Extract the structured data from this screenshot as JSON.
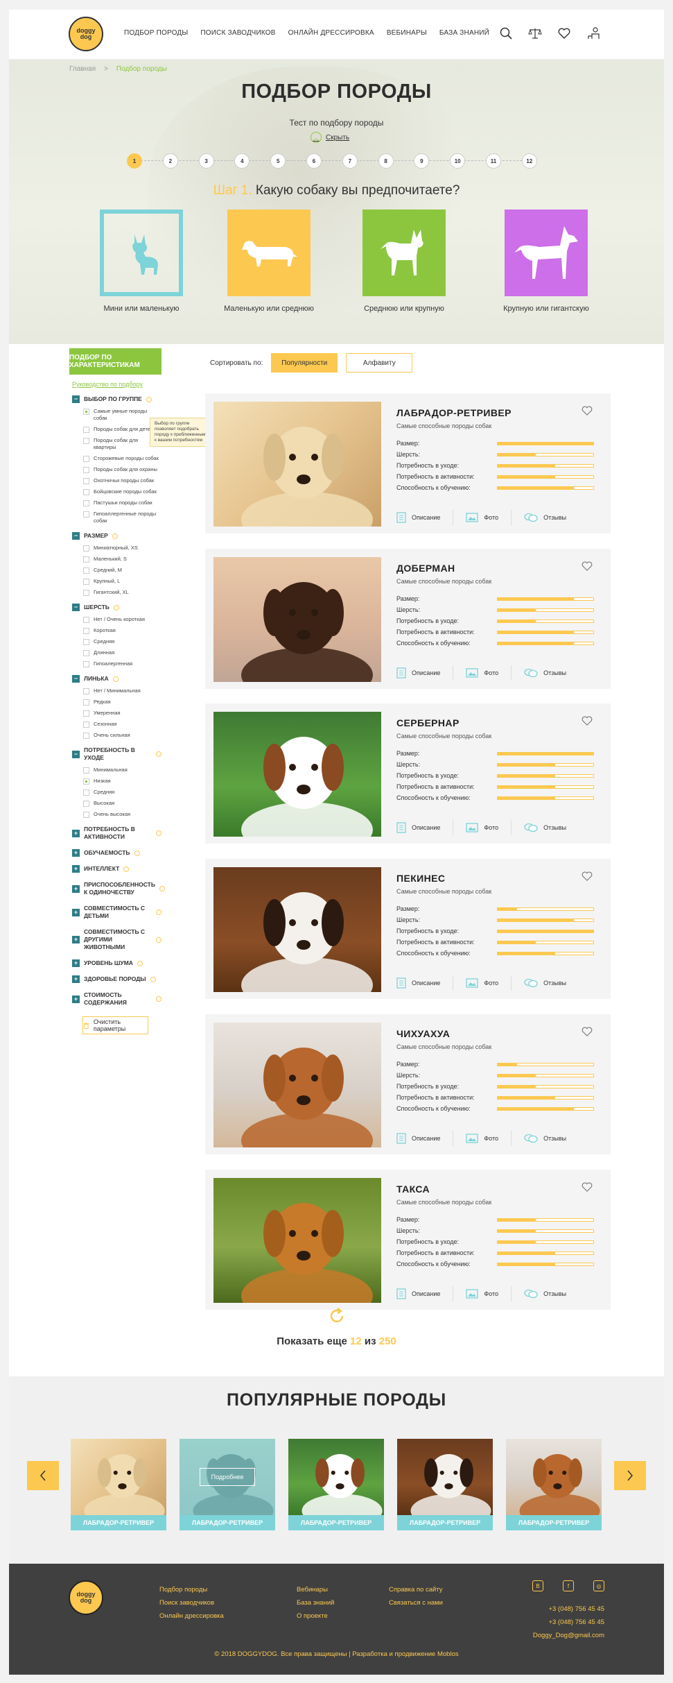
{
  "logo": {
    "line1": "doggy",
    "line2": "dog"
  },
  "nav": [
    "ПОДБОР ПОРОДЫ",
    "ПОИСК ЗАВОДЧИКОВ",
    "ОНЛАЙН ДРЕССИРОВКА",
    "ВЕБИНАРЫ",
    "БАЗА ЗНАНИЙ"
  ],
  "breadcrumb": {
    "home": "Главная",
    "sep": ">",
    "current": "Подбор породы"
  },
  "hero": {
    "title": "ПОДБОР ПОРОДЫ",
    "subtitle": "Тест по подбору породы",
    "hide": "Скрыть",
    "step_prefix": "Шаг 1.",
    "question": "Какую собаку вы предпочитаете?"
  },
  "steps": [
    "1",
    "2",
    "3",
    "4",
    "5",
    "6",
    "7",
    "8",
    "9",
    "10",
    "11",
    "12"
  ],
  "sizes": [
    {
      "label": "Мини или маленькую",
      "color": "#7dd3d8"
    },
    {
      "label": "Маленькую или среднюю",
      "color": "#fcc850"
    },
    {
      "label": "Среднюю или крупную",
      "color": "#8cc63f"
    },
    {
      "label": "Крупную или гигантскую",
      "color": "#cc6fe8"
    }
  ],
  "sidebar": {
    "header": "ПОДБОР ПО ХАРАКТЕРИСТИКАМ",
    "guide": "Руководство по подбору",
    "tooltip": "Выбор по группе позволяет подобрать породу к приближенным к вашим потребностям",
    "clear": "Очистить параметры",
    "groups": [
      {
        "title": "ВЫБОР ПО ГРУППЕ",
        "open": true,
        "options": [
          {
            "label": "Самые умные породы собак",
            "on": true
          },
          {
            "label": "Породы собак для детей"
          },
          {
            "label": "Породы собак для квартиры"
          },
          {
            "label": "Сторожевые породы собак"
          },
          {
            "label": "Породы собак для охраны"
          },
          {
            "label": "Охотничьи породы собак"
          },
          {
            "label": "Бойцовские породы собак"
          },
          {
            "label": "Пастушьи породы собак"
          },
          {
            "label": "Гипоаллергенные породы собак"
          }
        ]
      },
      {
        "title": "РАЗМЕР",
        "open": true,
        "options": [
          {
            "label": "Миниатюрный, XS"
          },
          {
            "label": "Маленький, S"
          },
          {
            "label": "Средний, M"
          },
          {
            "label": "Крупный, L"
          },
          {
            "label": "Гигантский, XL"
          }
        ]
      },
      {
        "title": "ШЕРСТЬ",
        "open": true,
        "options": [
          {
            "label": "Нет / Очень короткая"
          },
          {
            "label": "Короткая"
          },
          {
            "label": "Средняя"
          },
          {
            "label": "Длинная"
          },
          {
            "label": "Гипоалергенная"
          }
        ]
      },
      {
        "title": "ЛИНЬКА",
        "open": true,
        "options": [
          {
            "label": "Нет / Минимальная"
          },
          {
            "label": "Редкая"
          },
          {
            "label": "Умеренная"
          },
          {
            "label": "Сезонная"
          },
          {
            "label": "Очень сильная"
          }
        ]
      },
      {
        "title": "ПОТРЕБНОСТЬ В УХОДЕ",
        "open": true,
        "options": [
          {
            "label": "Минимальная"
          },
          {
            "label": "Низкая",
            "on": true
          },
          {
            "label": "Средняя"
          },
          {
            "label": "Высокая"
          },
          {
            "label": "Очень высокая"
          }
        ]
      },
      {
        "title": "ПОТРЕБНОСТЬ В АКТИВНОСТИ",
        "open": false
      },
      {
        "title": "ОБУЧАЕМОСТЬ",
        "open": false
      },
      {
        "title": "ИНТЕЛЛЕКТ",
        "open": false
      },
      {
        "title": "ПРИСПОСОБЛЕННОСТЬ К ОДИНОЧЕСТВУ",
        "open": false
      },
      {
        "title": "СОВМЕСТИМОСТЬ С ДЕТЬМИ",
        "open": false
      },
      {
        "title": "СОВМЕСТИМОСТЬ С ДРУГИМИ ЖИВОТНЫМИ",
        "open": false
      },
      {
        "title": "УРОВЕНЬ ШУМА",
        "open": false
      },
      {
        "title": "ЗДОРОВЬЕ ПОРОДЫ",
        "open": false
      },
      {
        "title": "СТОИМОСТЬ СОДЕРЖАНИЯ",
        "open": false
      }
    ]
  },
  "sort": {
    "label": "Сортировать по:",
    "options": [
      "Популярности",
      "Алфавиту"
    ],
    "active": 0
  },
  "trait_labels": [
    "Размер:",
    "Шерсть:",
    "Потребность в уходе:",
    "Потребность в активности:",
    "Способность к обучению:"
  ],
  "actions": [
    "Описание",
    "Фото",
    "Отзывы"
  ],
  "breeds": [
    {
      "name": "ЛАБРАДОР-РЕТРИВЕР",
      "desc": "Самые способные породы собак",
      "levels": [
        1,
        0.4,
        0.6,
        0.6,
        0.8
      ],
      "photo": "labrador"
    },
    {
      "name": "ДОБЕРМАН",
      "desc": "Самые способные породы собак",
      "levels": [
        0.8,
        0.4,
        0.4,
        0.8,
        0.8
      ],
      "photo": "doberman"
    },
    {
      "name": "СЕРБЕРНАР",
      "desc": "Самые способные породы собак",
      "levels": [
        1,
        0.6,
        0.6,
        0.6,
        0.6
      ],
      "photo": "stbernard"
    },
    {
      "name": "ПЕКИНЕС",
      "desc": "Самые способные породы собак",
      "levels": [
        0.2,
        0.8,
        1,
        0.4,
        0.6
      ],
      "photo": "pekinese"
    },
    {
      "name": "ЧИХУАХУА",
      "desc": "Самые способные породы собак",
      "levels": [
        0.2,
        0.4,
        0.4,
        0.6,
        0.8
      ],
      "photo": "chihuahua"
    },
    {
      "name": "ТАКСА",
      "desc": "Самые способные породы собак",
      "levels": [
        0.4,
        0.4,
        0.4,
        0.6,
        0.6
      ],
      "photo": "dachshund"
    }
  ],
  "more": {
    "prefix": "Показать еще",
    "count": "12",
    "mid": "из",
    "total": "250"
  },
  "popular": {
    "title": "ПОПУЛЯРНЫЕ ПОРОДЫ",
    "more_label": "Подробнее",
    "items": [
      {
        "label": "ЛАБРАДОР-РЕТРИВЕР",
        "photo": "labrador"
      },
      {
        "label": "ЛАБРАДОР-РЕТРИВЕР",
        "photo": "doberman",
        "hover": true
      },
      {
        "label": "ЛАБРАДОР-РЕТРИВЕР",
        "photo": "stbernard"
      },
      {
        "label": "ЛАБРАДОР-РЕТРИВЕР",
        "photo": "pekinese"
      },
      {
        "label": "ЛАБРАДОР-РЕТРИВЕР",
        "photo": "chihuahua"
      }
    ]
  },
  "footer": {
    "col1": [
      "Подбор породы",
      "Поиск заводчиков",
      "Онлайн дрессировка"
    ],
    "col2": [
      "Вебинары",
      "База знаний",
      "О проекте"
    ],
    "col3": [
      "Справка по сайту",
      "Связаться с нами"
    ],
    "phones": [
      "+3 (048) 756 45 45",
      "+3 (048) 756 45 45"
    ],
    "email": "Doggy_Dog@gmail.com",
    "copyright": "© 2018 DOGGYDOG. Все права защищены | Разработка и продвижение Moblos"
  },
  "colors": {
    "accent": "#fcc850",
    "green": "#8cc63f",
    "teal": "#7dd3d8",
    "dark": "#404040"
  }
}
